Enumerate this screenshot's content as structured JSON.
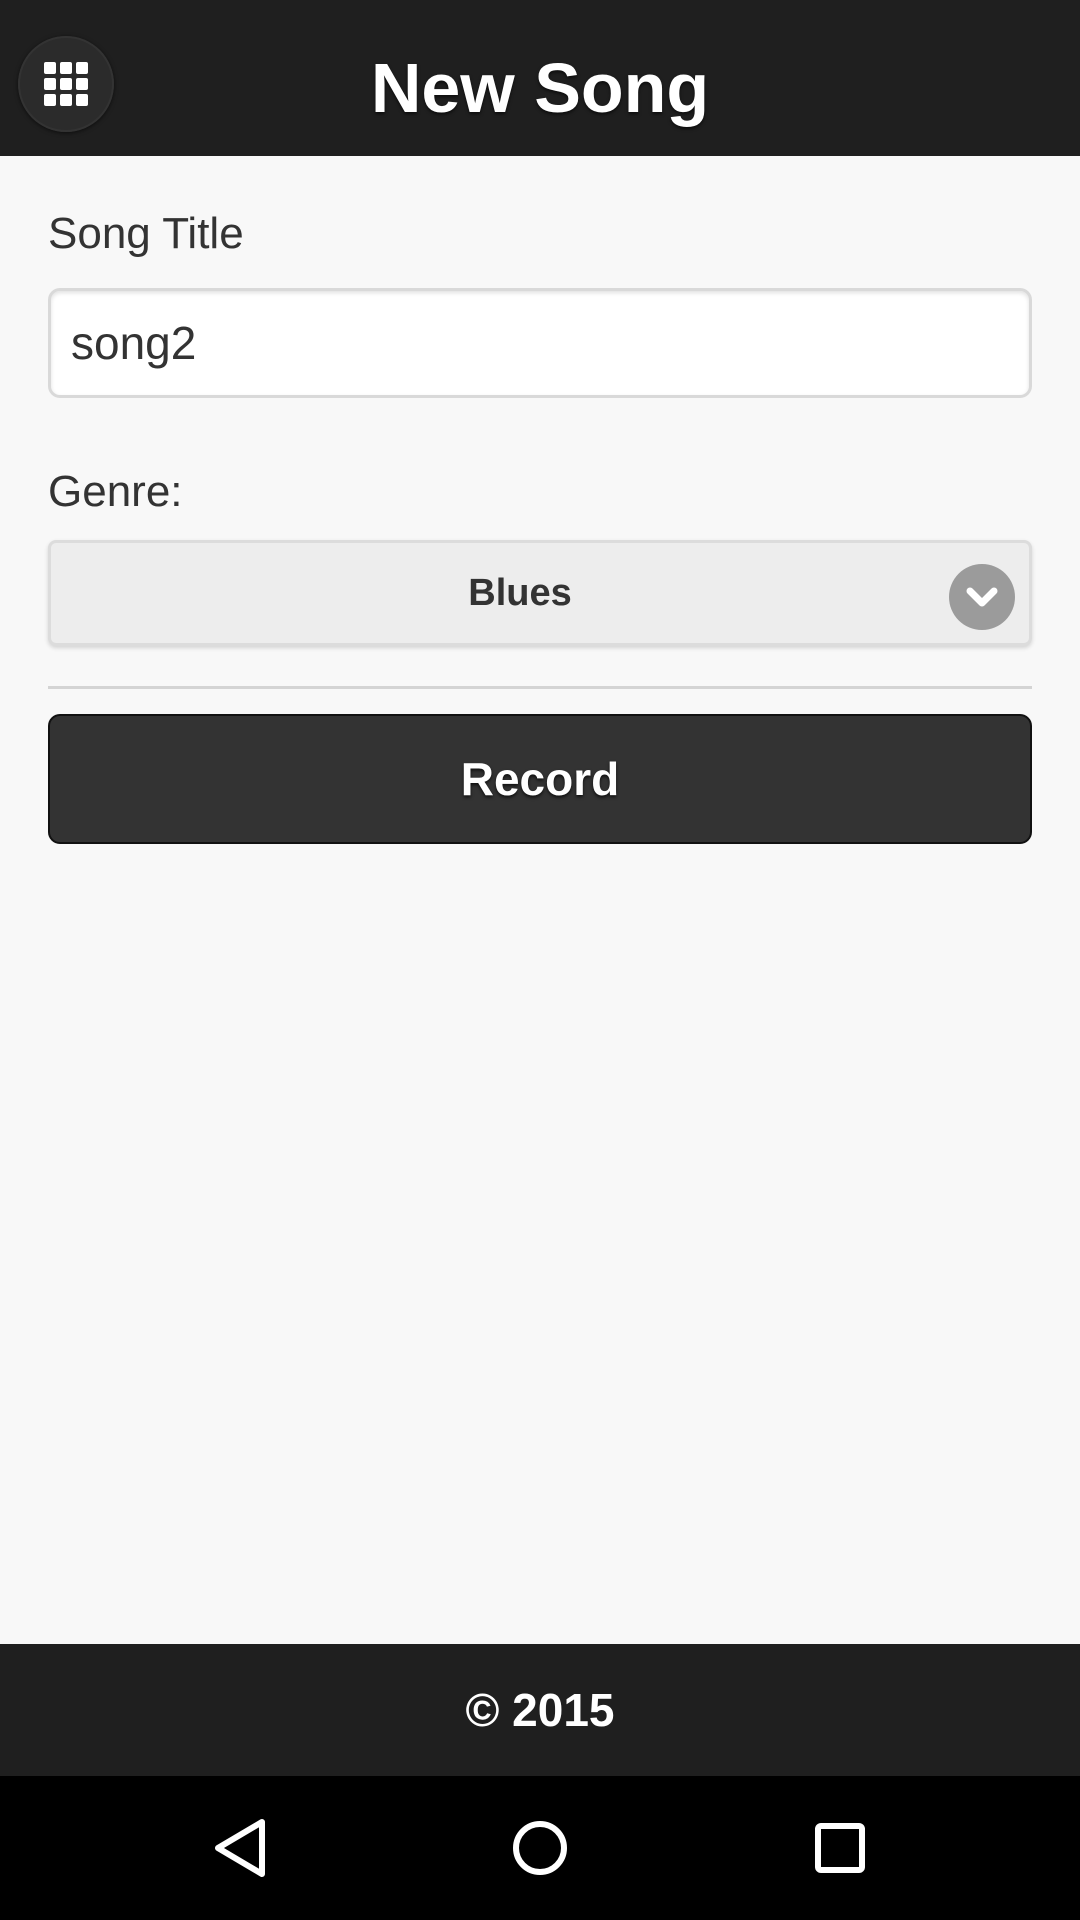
{
  "header": {
    "title": "New Song",
    "menu_icon": "grid-icon"
  },
  "form": {
    "song_title_label": "Song Title",
    "song_title_value": "song2",
    "genre_label": "Genre:",
    "genre_selected": "Blues",
    "genre_icon": "chevron-down-icon",
    "record_label": "Record"
  },
  "footer": {
    "text": "© 2015"
  },
  "navbar": {
    "back_icon": "back-triangle-icon",
    "home_icon": "home-circle-icon",
    "recents_icon": "recents-square-icon"
  },
  "colors": {
    "header_bg": "#1f1f1f",
    "page_bg": "#f8f8f8",
    "button_bg": "#333333",
    "navbar_bg": "#000000"
  }
}
